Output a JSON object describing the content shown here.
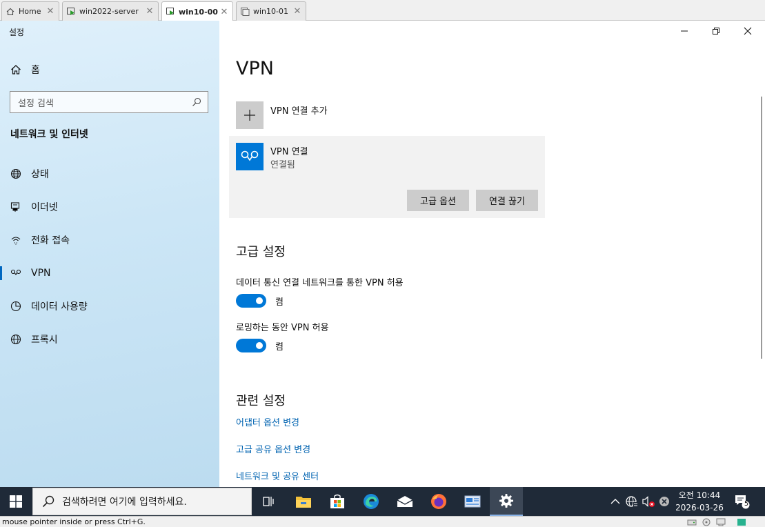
{
  "vm_tabs": [
    {
      "label": "Home",
      "icon": "home-icon"
    },
    {
      "label": "win2022-server",
      "icon": "vm-running-icon"
    },
    {
      "label": "win10-00",
      "icon": "vm-running-icon",
      "active": true
    },
    {
      "label": "win10-01",
      "icon": "vm-icon"
    }
  ],
  "settings": {
    "app_title": "설정",
    "home_label": "홈",
    "search_placeholder": "설정 검색",
    "section_heading": "네트워크 및 인터넷",
    "nav": [
      {
        "label": "상태",
        "icon": "globe-status-icon"
      },
      {
        "label": "이더넷",
        "icon": "ethernet-icon"
      },
      {
        "label": "전화 접속",
        "icon": "dialup-icon"
      },
      {
        "label": "VPN",
        "icon": "vpn-icon",
        "selected": true
      },
      {
        "label": "데이터 사용량",
        "icon": "data-usage-icon"
      },
      {
        "label": "프록시",
        "icon": "proxy-globe-icon"
      }
    ]
  },
  "main": {
    "title": "VPN",
    "add_vpn_label": "VPN 연결 추가",
    "connection": {
      "name": "VPN 연결",
      "status": "연결됨",
      "advanced_button": "고급 옵션",
      "disconnect_button": "연결 끊기"
    },
    "advanced_heading": "고급 설정",
    "options": [
      {
        "label": "데이터 통신 연결 네트워크를 통한 VPN 허용",
        "state": "켬",
        "on": true
      },
      {
        "label": "로밍하는 동안 VPN 허용",
        "state": "켬",
        "on": true
      }
    ],
    "related_heading": "관련 설정",
    "related_links": [
      "어댑터 옵션 변경",
      "고급 공유 옵션 변경",
      "네트워크 및 공유 센터"
    ]
  },
  "taskbar": {
    "search_placeholder": "검색하려면 여기에 입력하세요.",
    "apps": [
      "task-view-icon",
      "file-explorer-icon",
      "store-icon",
      "edge-icon",
      "mail-icon",
      "firefox-icon",
      "vm-app-icon",
      "settings-gear-icon"
    ],
    "clock_time": "오전 10:44",
    "clock_date": "2026-03-26",
    "notification_count": "5"
  },
  "statusbar": {
    "text": "mouse pointer inside or press Ctrl+G."
  },
  "colors": {
    "accent": "#0078d7",
    "link": "#0063b1",
    "taskbar": "#1f2a38"
  }
}
